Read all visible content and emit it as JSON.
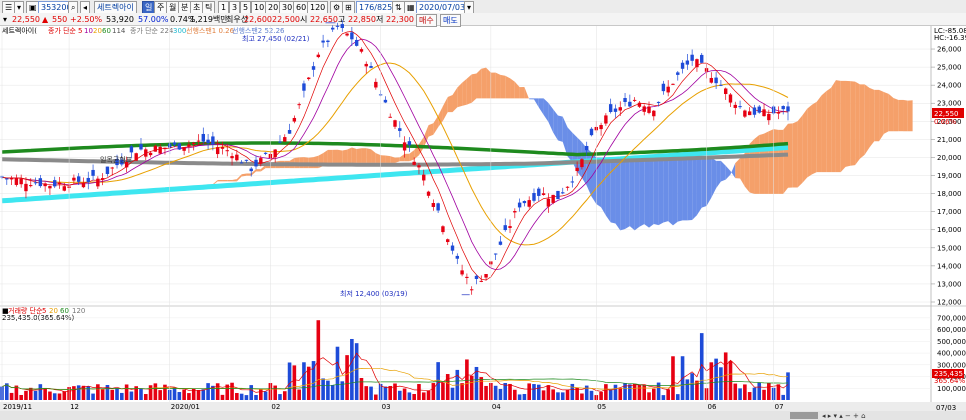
{
  "toolbar": {
    "code": "353200",
    "name": "세트렉아이",
    "views": [
      "일",
      "주",
      "월",
      "분",
      "초",
      "틱"
    ],
    "intervals": [
      "1",
      "3",
      "5",
      "10",
      "20",
      "30",
      "60",
      "120"
    ],
    "count": "176/825",
    "date": "2020/07/03"
  },
  "quote": {
    "price": "22,550",
    "change": "550",
    "change_pct": "+2.50%",
    "volume": "53,920",
    "vol_ratio": "57.00%",
    "turnover_ratio": "0.74%",
    "amount": "1,219백만",
    "label_best": "최우선",
    "best_bid": "22,600",
    "best_ask": "22,500",
    "open_label": "시",
    "open": "22,650",
    "high_label": "고",
    "high": "22,850",
    "low_label": "저",
    "low": "22,300",
    "buy_label": "매수",
    "sell_label": "매도"
  },
  "legend": {
    "title": "세트렉아이(",
    "ma_label": "종가 단순",
    "ma_periods": [
      "5",
      "10",
      "20",
      "60",
      "114"
    ],
    "ma2_label": "종가 단순",
    "ma2_periods": [
      "224",
      "300"
    ],
    "span_a": "선행스팬1 0.26",
    "span_b": "선행스팬2 52.26",
    "lc": "LC:-85.08",
    "hc": "HC:-16.39"
  },
  "annotations": {
    "high": "최고 27,450 (02/21)",
    "low": "최저 12,400 (03/19)",
    "ichimoku": "일목균형표",
    "cur_price": "22,550",
    "cur_pct": "0.66%"
  },
  "price_axis": [
    "26,000",
    "25,000",
    "24,000",
    "23,000",
    "22,000",
    "21,000",
    "20,000",
    "19,000",
    "18,000",
    "17,000",
    "16,000",
    "15,000",
    "14,000",
    "13,000",
    "12,000"
  ],
  "volume_panel": {
    "label": "거래량 단순",
    "ma_periods": [
      "5",
      "20",
      "60",
      "120"
    ],
    "value": "235,435.0(365.64%)",
    "axis": [
      "700,000",
      "600,000",
      "500,000",
      "400,000",
      "300,000",
      "200,000",
      "100,000"
    ],
    "cur_value": "235,435",
    "cur_pct": "365.64%"
  },
  "date_axis": [
    "2019/11",
    "12",
    "2020/01",
    "02",
    "03",
    "04",
    "05",
    "06",
    "07"
  ],
  "date_right": "07/03",
  "chart_data": {
    "type": "candlestick",
    "x": [
      "2019/11",
      "12",
      "2020/01",
      "02",
      "03",
      "04",
      "05",
      "06",
      "07"
    ],
    "high_point": {
      "value": 27450,
      "date": "02/21"
    },
    "low_point": {
      "value": 12400,
      "date": "03/19"
    },
    "last_close": 22550,
    "last_volume": 235435,
    "ylim": [
      12000,
      26500
    ],
    "volume_ylim": [
      0,
      750000
    ],
    "colors": {
      "up": "#e60012",
      "down": "#1e4bd8",
      "cloud_up": "#f5a06a",
      "cloud_down": "#6a8ee8",
      "ma60": "#1e8a1e",
      "ma224": "#8a8a8a",
      "ma300": "#3ee6f0"
    }
  }
}
